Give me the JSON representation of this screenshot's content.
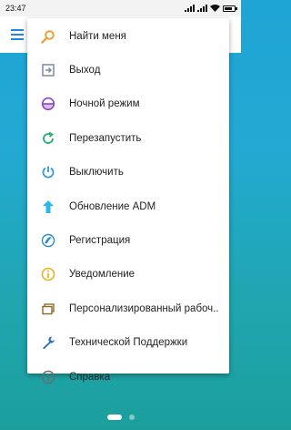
{
  "status": {
    "time": "23:47"
  },
  "menu": {
    "items": [
      {
        "label": "Найти меня",
        "icon": "search-icon",
        "color": "#e8a33d"
      },
      {
        "label": "Выход",
        "icon": "logout-icon",
        "color": "#7c8aa8"
      },
      {
        "label": "Ночной режим",
        "icon": "night-mode-icon",
        "color": "#8e44c8"
      },
      {
        "label": "Перезапустить",
        "icon": "restart-icon",
        "color": "#23b06f"
      },
      {
        "label": "Выключить",
        "icon": "power-icon",
        "color": "#2e9ad8"
      },
      {
        "label": "Обновление ADM",
        "icon": "upload-icon",
        "color": "#2db8e6"
      },
      {
        "label": "Регистрация",
        "icon": "register-icon",
        "color": "#2a8ccf"
      },
      {
        "label": "Уведомление",
        "icon": "info-warning-icon",
        "color": "#e6b422"
      },
      {
        "label": "Персонализированный рабоч..",
        "icon": "workspace-icon",
        "color": "#8a6a2a"
      },
      {
        "label": "Технической Поддержки",
        "icon": "wrench-icon",
        "color": "#2c6fb8"
      },
      {
        "label": "Справка",
        "icon": "help-info-icon",
        "color": "#6b6b6b"
      }
    ]
  },
  "colors": {
    "accent": "#1e88e5",
    "background": "#22a6c9"
  }
}
